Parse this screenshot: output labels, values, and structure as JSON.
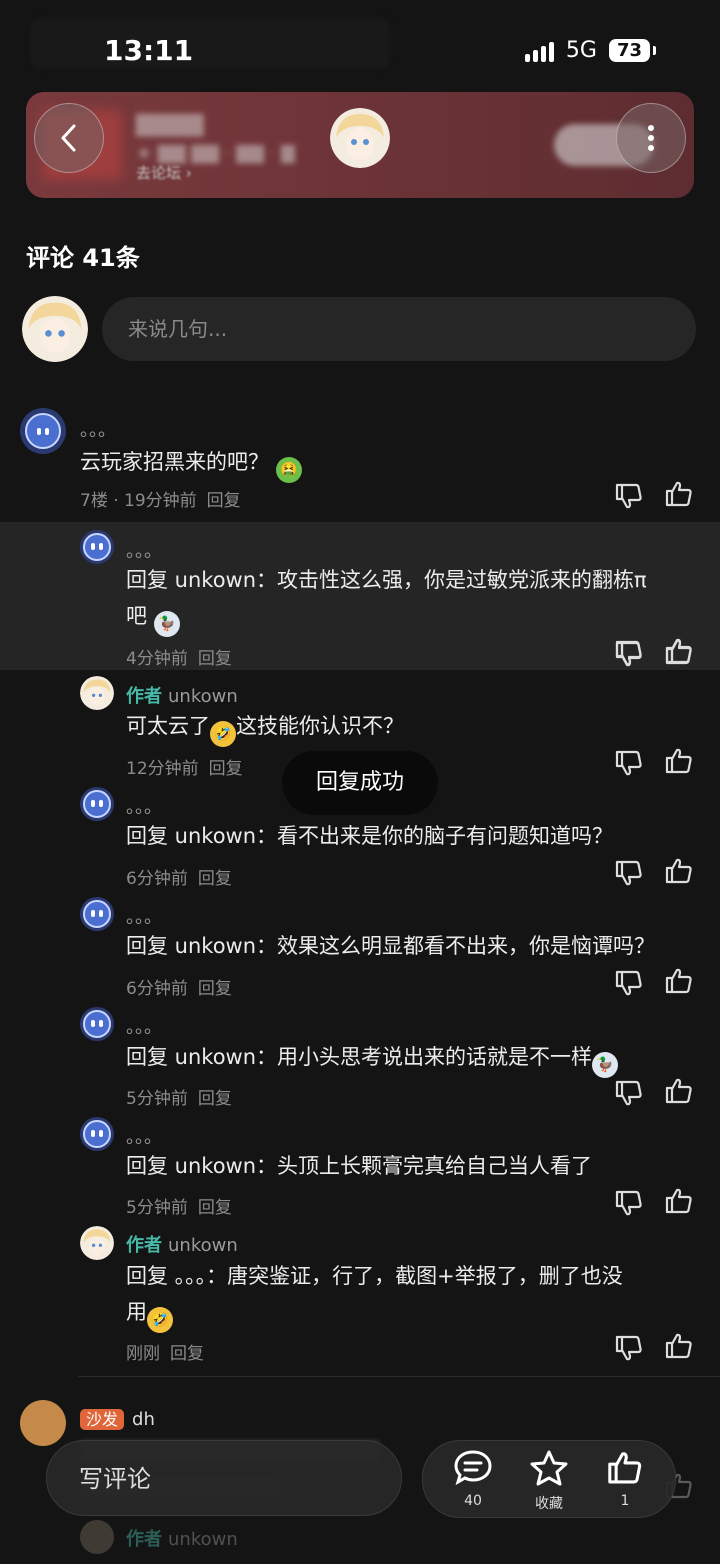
{
  "status": {
    "time": "13:11",
    "network": "5G",
    "battery": "73"
  },
  "header": {
    "forum_link": "去论坛"
  },
  "comments_section": {
    "title": "评论 41条",
    "input_placeholder": "来说几句..."
  },
  "comments": [
    {
      "nick": "。。。",
      "text": "云玩家招黑来的吧？",
      "floor_time": "7楼 · 19分钟前",
      "reply": "回复",
      "emoji": "🤮"
    },
    {
      "nick": "。。。",
      "text": "回复 unkown：攻击性这么强，你是过敏党派来的翻栋π",
      "text2": "吧",
      "time": "4分钟前",
      "reply": "回复",
      "emoji": "🦆"
    },
    {
      "tag": "作者",
      "nick": "unkown",
      "text_a": "可太云了",
      "text_b": "这技能你认识不？",
      "time": "12分钟前",
      "reply": "回复",
      "emoji": "🤣"
    },
    {
      "nick": "。。。",
      "text": "回复 unkown：看不出来是你的脑子有问题知道吗？",
      "time": "6分钟前",
      "reply": "回复"
    },
    {
      "nick": "。。。",
      "text": "回复 unkown：效果这么明显都看不出来，你是恼谭吗？",
      "time": "6分钟前",
      "reply": "回复"
    },
    {
      "nick": "。。。",
      "text": "回复 unkown：用小头思考说出来的话就是不一样",
      "time": "5分钟前",
      "reply": "回复",
      "emoji": "🦆"
    },
    {
      "nick": "。。。",
      "text": "回复 unkown：头顶上长颗膏完真给自己当人看了",
      "time": "5分钟前",
      "reply": "回复"
    },
    {
      "tag": "作者",
      "nick": "unkown",
      "text": "回复 。。。：唐突鉴证，行了，截图+举报了，删了也没",
      "text2": "用",
      "time": "刚刚",
      "reply": "回复",
      "emoji": "🤣"
    },
    {
      "tag": "沙发",
      "nick": "dh"
    },
    {
      "tag": "作者",
      "nick": "unkown"
    }
  ],
  "toast": "回复成功",
  "bottom_bar": {
    "write_label": "写评论",
    "comment_count": "40",
    "favorite_label": "收藏",
    "like_count": "1"
  }
}
